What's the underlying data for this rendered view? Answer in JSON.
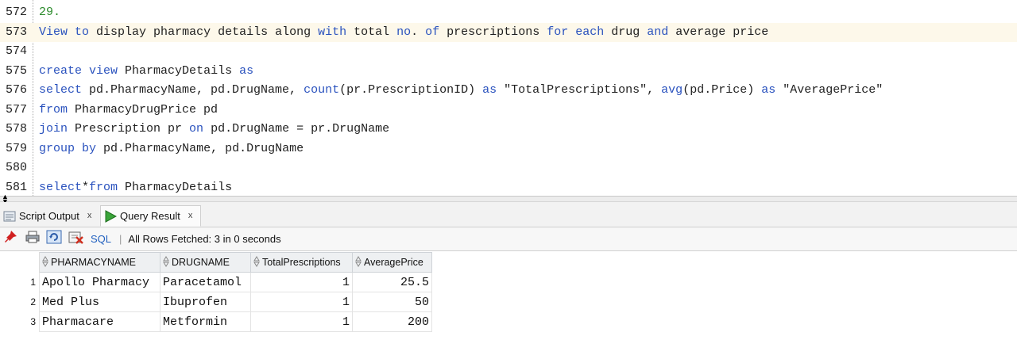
{
  "editor": {
    "lines": [
      {
        "no": "572",
        "segments": [
          {
            "t": "29.",
            "c": "num"
          }
        ]
      },
      {
        "no": "573",
        "highlight": true,
        "segments": [
          {
            "t": "View",
            "c": "kw"
          },
          {
            "t": " "
          },
          {
            "t": "to",
            "c": "kw"
          },
          {
            "t": " display pharmacy details along "
          },
          {
            "t": "with",
            "c": "kw"
          },
          {
            "t": " total "
          },
          {
            "t": "no",
            "c": "kw"
          },
          {
            "t": ". "
          },
          {
            "t": "of",
            "c": "kw"
          },
          {
            "t": " prescriptions "
          },
          {
            "t": "for",
            "c": "kw"
          },
          {
            "t": " "
          },
          {
            "t": "each",
            "c": "kw"
          },
          {
            "t": " drug "
          },
          {
            "t": "and",
            "c": "kw"
          },
          {
            "t": " average price"
          }
        ]
      },
      {
        "no": "574",
        "segments": []
      },
      {
        "no": "575",
        "segments": [
          {
            "t": "create",
            "c": "kw"
          },
          {
            "t": " "
          },
          {
            "t": "view",
            "c": "kw"
          },
          {
            "t": " PharmacyDetails "
          },
          {
            "t": "as",
            "c": "kw"
          }
        ]
      },
      {
        "no": "576",
        "segments": [
          {
            "t": "select",
            "c": "kw"
          },
          {
            "t": " pd.PharmacyName, pd.DrugName, "
          },
          {
            "t": "count",
            "c": "kw"
          },
          {
            "t": "(pr.PrescriptionID) "
          },
          {
            "t": "as",
            "c": "kw"
          },
          {
            "t": " \"TotalPrescriptions\", "
          },
          {
            "t": "avg",
            "c": "kw"
          },
          {
            "t": "(pd.Price) "
          },
          {
            "t": "as",
            "c": "kw"
          },
          {
            "t": " \"AveragePrice\""
          }
        ]
      },
      {
        "no": "577",
        "segments": [
          {
            "t": "from",
            "c": "kw"
          },
          {
            "t": " PharmacyDrugPrice pd"
          }
        ]
      },
      {
        "no": "578",
        "segments": [
          {
            "t": "join",
            "c": "kw"
          },
          {
            "t": " Prescription pr "
          },
          {
            "t": "on",
            "c": "kw"
          },
          {
            "t": " pd.DrugName = pr.DrugName"
          }
        ]
      },
      {
        "no": "579",
        "segments": [
          {
            "t": "group",
            "c": "kw"
          },
          {
            "t": " "
          },
          {
            "t": "by",
            "c": "kw"
          },
          {
            "t": " pd.PharmacyName, pd.DrugName"
          }
        ]
      },
      {
        "no": "580",
        "segments": []
      },
      {
        "no": "581",
        "segments": [
          {
            "t": "select",
            "c": "kw"
          },
          {
            "t": "*"
          },
          {
            "t": "from",
            "c": "kw"
          },
          {
            "t": " PharmacyDetails"
          }
        ]
      }
    ]
  },
  "tabs": {
    "script_output": "Script Output",
    "query_result": "Query Result",
    "close_glyph": "x"
  },
  "toolbar": {
    "sql_label": "SQL",
    "separator": "|",
    "status": "All Rows Fetched: 3 in 0 seconds"
  },
  "grid": {
    "columns": [
      "PHARMACYNAME",
      "DRUGNAME",
      "TotalPrescriptions",
      "AveragePrice"
    ],
    "rows": [
      {
        "n": "1",
        "cells": [
          "Apollo Pharmacy",
          "Paracetamol",
          "1",
          "25.5"
        ]
      },
      {
        "n": "2",
        "cells": [
          "Med Plus",
          "Ibuprofen",
          "1",
          "50"
        ]
      },
      {
        "n": "3",
        "cells": [
          "Pharmacare",
          "Metformin",
          "1",
          "200"
        ]
      }
    ]
  },
  "colors": {
    "keyword": "#2a52be",
    "number": "#2b8a2b",
    "current_line": "#fdf8ea"
  }
}
